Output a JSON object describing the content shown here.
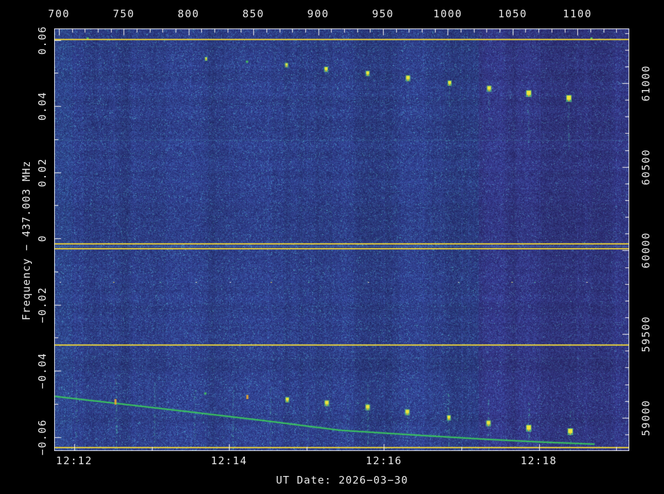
{
  "figure": {
    "background": "#000000",
    "axis_text_color": "#e9e9e9"
  },
  "chart_data": {
    "type": "heatmap",
    "description": "radio spectrogram waterfall with doppler prediction overlay",
    "title": "",
    "bottom_title": "UT Date: 2026−03−30",
    "ylabel": "Frequency − 437.003 MHz",
    "plot_bg_base": "#2c3880",
    "marker_line_color": "#e0ca3c",
    "doppler_curve_color": "#3cd45a",
    "streak_color": "#4ec8af",
    "frame_color": "#e8e8e8",
    "top_axis": {
      "major_ticks": [
        700,
        750,
        800,
        850,
        900,
        950,
        1000,
        1050,
        1100
      ],
      "minor_step": 10,
      "range": [
        696.3,
        1140.0
      ]
    },
    "bottom_axis": {
      "major_ticks": [
        {
          "label": "12:12",
          "t": 0
        },
        {
          "label": "12:14",
          "t": 120
        },
        {
          "label": "12:16",
          "t": 240
        },
        {
          "label": "12:18",
          "t": 360
        }
      ],
      "minor_ticks_t": [
        60,
        180,
        300,
        420
      ],
      "t_range_s": [
        -15.6,
        430.1
      ]
    },
    "left_axis": {
      "major_ticks": [
        {
          "label": "0.06",
          "f": 0.06
        },
        {
          "label": "0.04",
          "f": 0.04
        },
        {
          "label": "0.02",
          "f": 0.02
        },
        {
          "label": "0",
          "f": 0.0
        },
        {
          "label": "−0.02",
          "f": -0.02
        },
        {
          "label": "−0.04",
          "f": -0.04
        },
        {
          "label": "−0.06",
          "f": -0.06
        }
      ],
      "minor_step": 0.01,
      "f_range_MHz": [
        0.0634,
        -0.0643
      ]
    },
    "right_axis": {
      "major_ticks": [
        {
          "label": "61000",
          "v": 61000
        },
        {
          "label": "60500",
          "v": 60500
        },
        {
          "label": "60000",
          "v": 60000
        },
        {
          "label": "59500",
          "v": 59500
        },
        {
          "label": "59000",
          "v": 59000
        }
      ],
      "minor_step": 100,
      "range": [
        61327,
        58800
      ]
    },
    "marker_lines_f": [
      0.0604,
      -0.00147,
      -0.00293,
      -0.032,
      -0.063
    ],
    "faint_lines": [
      {
        "f": 0.058,
        "a": 0.28
      },
      {
        "f": 0.0297,
        "a": 0.33
      },
      {
        "f": -0.0022,
        "a": 0.85
      },
      {
        "f": -0.0362,
        "a": 0.18
      }
    ],
    "doppler_curve": [
      [
        -15.6,
        -0.04775
      ],
      [
        31.7,
        -0.04984
      ],
      [
        91.9,
        -0.05257
      ],
      [
        146.8,
        -0.05508
      ],
      [
        205.9,
        -0.05801
      ],
      [
        265.1,
        -0.05948
      ],
      [
        318.8,
        -0.06073
      ],
      [
        361.8,
        -0.06157
      ],
      [
        403.2,
        -0.0622
      ]
    ],
    "upper_track": [
      {
        "t": 102.2,
        "f": 0.05445,
        "s": 2,
        "k": "yellow"
      },
      {
        "t": 133.9,
        "f": 0.0534,
        "s": 3,
        "k": "green"
      },
      {
        "t": 164.5,
        "f": 0.05257,
        "s": 3,
        "k": "yellow"
      },
      {
        "t": 195.2,
        "f": 0.05131,
        "s": 4,
        "k": "yellow"
      },
      {
        "t": 227.4,
        "f": 0.05005,
        "s": 4,
        "k": "yellow"
      },
      {
        "t": 258.6,
        "f": 0.04859,
        "s": 5,
        "k": "yellow"
      },
      {
        "t": 290.9,
        "f": 0.04712,
        "s": 4,
        "k": "yellow"
      },
      {
        "t": 321.5,
        "f": 0.04545,
        "s": 5,
        "k": "yellow"
      },
      {
        "t": 352.2,
        "f": 0.04398,
        "s": 6,
        "k": "yellow"
      },
      {
        "t": 383.3,
        "f": 0.04251,
        "s": 6,
        "k": "yellow"
      }
    ],
    "lower_track": [
      {
        "t": 31.7,
        "f": -0.04942,
        "s": 4,
        "k": "orange"
      },
      {
        "t": 101.6,
        "f": -0.04691,
        "s": 3,
        "k": "green"
      },
      {
        "t": 133.9,
        "f": -0.04796,
        "s": 3,
        "k": "orange"
      },
      {
        "t": 165.1,
        "f": -0.04859,
        "s": 4,
        "k": "yellow"
      },
      {
        "t": 195.7,
        "f": -0.04963,
        "s": 5,
        "k": "yellow"
      },
      {
        "t": 227.4,
        "f": -0.05089,
        "s": 5,
        "k": "yellow"
      },
      {
        "t": 258.1,
        "f": -0.05236,
        "s": 5,
        "k": "yellow"
      },
      {
        "t": 290.3,
        "f": -0.05403,
        "s": 4,
        "k": "yellow"
      },
      {
        "t": 321.0,
        "f": -0.05571,
        "s": 5,
        "k": "yellow"
      },
      {
        "t": 352.2,
        "f": -0.05717,
        "s": 6,
        "k": "yellow"
      },
      {
        "t": 384.4,
        "f": -0.05822,
        "s": 6,
        "k": "yellow"
      }
    ],
    "streaks": [
      [
        1.6,
        -0.04272,
        -0.06408,
        0.45
      ],
      [
        32.8,
        -0.04209,
        -0.06408,
        0.9
      ],
      [
        62.4,
        -0.04356,
        -0.06408,
        0.55
      ],
      [
        93.5,
        -0.0444,
        -0.06366,
        0.5
      ],
      [
        123.1,
        -0.04482,
        -0.06408,
        0.6
      ],
      [
        152.2,
        -0.04524,
        -0.06366,
        0.5
      ],
      [
        181.2,
        -0.04565,
        -0.06408,
        0.5
      ],
      [
        211.8,
        -0.04733,
        -0.06304,
        0.3
      ],
      [
        227.4,
        -0.04356,
        -0.06199,
        0.5
      ],
      [
        258.1,
        -0.04524,
        -0.06304,
        0.55
      ],
      [
        290.3,
        -0.04691,
        -0.06366,
        0.55
      ],
      [
        321.0,
        -0.04838,
        -0.06408,
        0.6
      ],
      [
        352.2,
        -0.04963,
        -0.06408,
        0.6
      ],
      [
        384.4,
        -0.05215,
        -0.06408,
        0.6
      ],
      [
        195.2,
        0.05131,
        0.04482,
        0.22
      ],
      [
        227.4,
        0.05005,
        0.04272,
        0.28
      ],
      [
        258.6,
        0.04859,
        0.04063,
        0.28
      ],
      [
        290.9,
        0.04712,
        0.03853,
        0.32
      ],
      [
        321.5,
        0.04545,
        0.03435,
        0.38
      ],
      [
        352.2,
        0.04398,
        0.02702,
        0.45
      ],
      [
        383.3,
        0.04251,
        0.02702,
        0.45
      ]
    ],
    "dotted_row": {
      "f": -0.0132,
      "t": [
        -11.3,
        30.1,
        66.1,
        94.1,
        120.4,
        152.2,
        181.2,
        227.4,
        297.3,
        338.7,
        356.5,
        396.8
      ]
    },
    "top_line_blips_t": [
      9.7,
      400.0
    ],
    "time_grid_step_s": 30
  }
}
